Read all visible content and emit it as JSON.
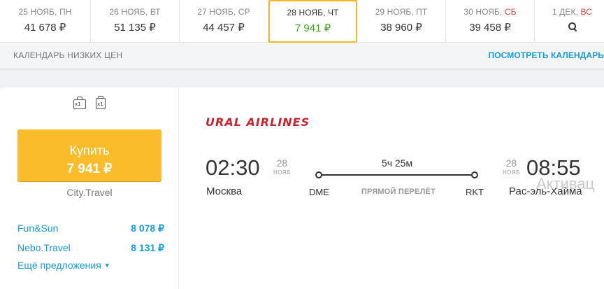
{
  "dates": [
    {
      "label": "25 НОЯБ, ПН",
      "weekday_weekend": "",
      "price": "41 678 ₽"
    },
    {
      "label": "26 НОЯБ, ВТ",
      "weekday_weekend": "",
      "price": "51 135 ₽"
    },
    {
      "label": "27 НОЯБ, СР",
      "weekday_weekend": "",
      "price": "44 457 ₽"
    },
    {
      "label": "28 НОЯБ, ЧТ",
      "weekday_weekend": "",
      "price": "7 941 ₽"
    },
    {
      "label": "29 НОЯБ, ПТ",
      "weekday_weekend": "",
      "price": "38 960 ₽"
    },
    {
      "label": "30 НОЯБ, ",
      "weekday_weekend": "СБ",
      "price": "39 458 ₽"
    },
    {
      "label": "1 ДЕК, ",
      "weekday_weekend": "ВС",
      "price": ""
    }
  ],
  "calendar": {
    "left_label": "КАЛЕНДАРЬ НИЗКИХ ЦЕН",
    "right_link": "ПОСМОТРЕТЬ КАЛЕНДАРЬ"
  },
  "baggage": {
    "hand": "x1",
    "luggage": "x1"
  },
  "buy": {
    "label": "Купить",
    "price": "7 941 ₽"
  },
  "agency": "City.Travel",
  "offers": [
    {
      "name": "Fun&Sun",
      "price": "8 078 ₽"
    },
    {
      "name": "Nebo.Travel",
      "price": "8 131 ₽"
    }
  ],
  "more_offers": "Ещё предложения",
  "airline": "URAL AIRLINES",
  "flight": {
    "dep_time": "02:30",
    "dep_day": "28",
    "dep_month": "НОЯБ",
    "dep_city": "Москва",
    "dep_iata": "DME",
    "duration": "5ч 25м",
    "direct": "ПРЯМОЙ ПЕРЕЛЁТ",
    "arr_time": "08:55",
    "arr_day": "28",
    "arr_month": "НОЯБ",
    "arr_city": "Рас-эль-Хайма",
    "arr_iata": "RKT"
  },
  "watermark": "Активац",
  "colors": {
    "accent_yellow": "#fbbc2c",
    "link_blue": "#1a9bd7",
    "price_green": "#3ea21c",
    "weekend_red": "#e0473f",
    "airline_red": "#c8242f"
  }
}
